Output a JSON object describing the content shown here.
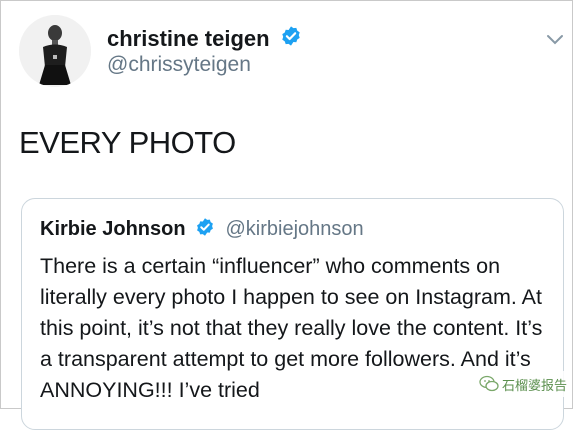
{
  "tweet": {
    "author_name": "christine teigen",
    "author_handle": "@chrissyteigen",
    "text": "EVERY PHOTO",
    "verified": true
  },
  "quoted_tweet": {
    "author_name": "Kirbie Johnson",
    "author_handle": "@kirbiejohnson",
    "verified": true,
    "text": "There is a certain “influencer” who comments on literally every photo I happen to see on Instagram. At this point, it’s not that they really love the content. It’s a transparent attempt to get more followers. And it’s ANNOYING!!! I’ve tried"
  },
  "watermark": {
    "text": "石榴婆报告",
    "icon": "wechat-icon"
  },
  "colors": {
    "verified_badge": "#1da1f2",
    "handle": "#657786",
    "border": "#ccd6dd"
  }
}
